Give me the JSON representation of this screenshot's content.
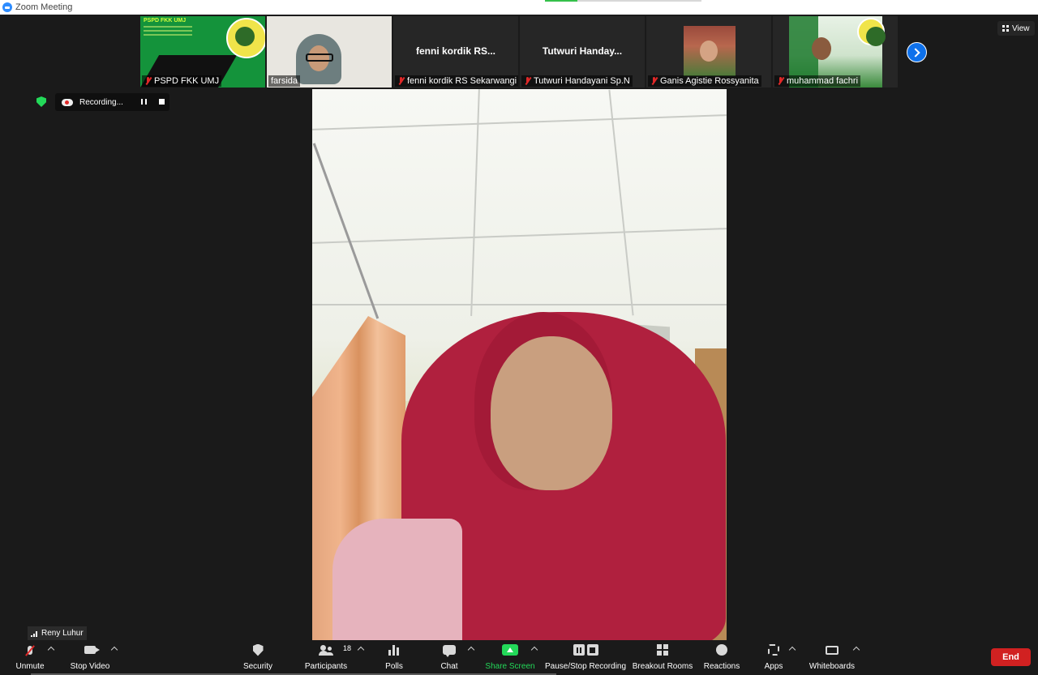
{
  "window": {
    "title": "Zoom Meeting"
  },
  "participants_strip": [
    {
      "name": "PSPD FKK UMJ",
      "muted": true,
      "type": "slide",
      "slide_text": "PSPD FKK UMJ"
    },
    {
      "name": "farsida",
      "muted": false,
      "type": "video"
    },
    {
      "name": "fenni kordik RS Sekarwangi",
      "display_title": "fenni  kordik  RS...",
      "muted": true,
      "type": "name-only"
    },
    {
      "name": "Tutwuri Handayani Sp.N",
      "display_title": "Tutwuri  Handay...",
      "muted": true,
      "type": "name-only"
    },
    {
      "name": "Ganis Agistie Rossyanita",
      "muted": true,
      "type": "photo"
    },
    {
      "name": "muhammad fachri",
      "muted": true,
      "type": "slide"
    }
  ],
  "view_button": {
    "label": "View"
  },
  "recording": {
    "status": "Recording..."
  },
  "active_speaker": {
    "name": "Reny Luhur"
  },
  "toolbar": {
    "unmute": "Unmute",
    "stop_video": "Stop Video",
    "security": "Security",
    "participants": "Participants",
    "participants_count": "18",
    "polls": "Polls",
    "chat": "Chat",
    "share_screen": "Share Screen",
    "pause_stop_recording": "Pause/Stop Recording",
    "breakout_rooms": "Breakout Rooms",
    "reactions": "Reactions",
    "apps": "Apps",
    "whiteboards": "Whiteboards",
    "end": "End"
  },
  "colors": {
    "accent": "#0e71eb",
    "share": "#23d959",
    "end": "#d12121",
    "muted": "#e02828"
  },
  "icons": [
    "zoom-logo-icon",
    "mic-off-icon",
    "next-page-icon",
    "view-grid-icon",
    "encryption-shield-icon",
    "recording-cloud-icon",
    "pause-icon",
    "stop-icon",
    "signal-icon",
    "mic-icon",
    "camera-icon",
    "security-icon",
    "participants-icon",
    "polls-icon",
    "chat-icon",
    "share-screen-icon",
    "pause-stop-recording-icon",
    "breakout-rooms-icon",
    "reactions-icon",
    "apps-icon",
    "whiteboards-icon"
  ]
}
